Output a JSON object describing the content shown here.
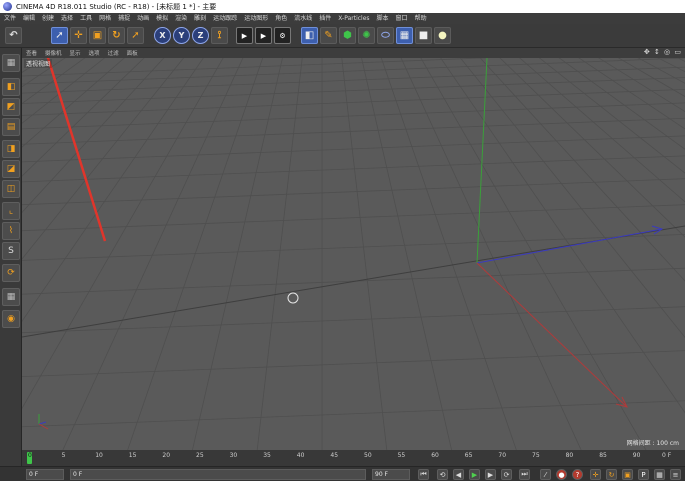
{
  "window": {
    "title": "CINEMA 4D R18.011 Studio (RC - R18) - [未标题 1 *] - 主要"
  },
  "menubar": {
    "items": [
      "文件",
      "编辑",
      "创建",
      "选择",
      "工具",
      "网格",
      "捕捉",
      "动画",
      "模拟",
      "渲染",
      "雕刻",
      "运动跟踪",
      "运动图形",
      "角色",
      "流水线",
      "插件",
      "X-Particles",
      "脚本",
      "窗口",
      "帮助"
    ]
  },
  "viewport": {
    "menu": [
      "查看",
      "摄像机",
      "显示",
      "选项",
      "过滤",
      "面板"
    ],
    "label": "透视视图",
    "grid_info": "网格间距 : 100 cm",
    "nav_icons": "✥ ↕ ◎ ▭"
  },
  "timeline": {
    "ticks": [
      "0",
      "5",
      "10",
      "15",
      "20",
      "25",
      "30",
      "35",
      "40",
      "45",
      "50",
      "55",
      "60",
      "65",
      "70",
      "75",
      "80",
      "85",
      "90"
    ],
    "current_frame_marker": "0",
    "end_label": "0 F"
  },
  "transport": {
    "current_frame": "0 F",
    "start_frame": "0 F",
    "end_frame": "90 F",
    "end_frame2": "90 F"
  },
  "colors": {
    "viewport_bg": "#5a5a5a",
    "grid_line": "#4d4d4d",
    "axis_x": "#c03a3a",
    "axis_y": "#3aa03a",
    "axis_z": "#3a3ac0",
    "annotation_arrow": "#e0352b"
  },
  "icons": {
    "toolbar": [
      "undo-icon",
      "select-icon",
      "move-icon",
      "scale-icon",
      "rotate-icon",
      "recent-tool-icon",
      "x-axis-lock-icon",
      "y-axis-lock-icon",
      "z-axis-lock-icon",
      "coordinate-system-icon",
      "render-view-icon",
      "render-picture-viewer-icon",
      "render-settings-icon",
      "cube-primitive-icon",
      "spline-pen-icon",
      "subdivision-icon",
      "array-icon",
      "deformer-icon",
      "environment-icon",
      "camera-icon",
      "light-icon"
    ],
    "left": [
      "make-editable-icon",
      "model-mode-icon",
      "texture-mode-icon",
      "workplane-icon",
      "points-mode-icon",
      "edges-mode-icon",
      "polygons-mode-icon",
      "axis-mode-icon",
      "tweak-mode-icon",
      "snap-icon",
      "soft-selection-icon",
      "lock-workplane-icon",
      "solo-icon"
    ]
  }
}
